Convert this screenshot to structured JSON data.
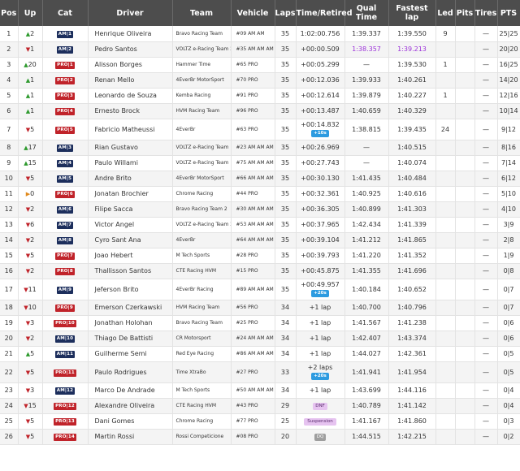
{
  "headers": [
    "Pos",
    "Up",
    "Cat",
    "Driver",
    "Team",
    "Vehicle",
    "Laps",
    "Time/Retired",
    "Qual Time",
    "Fastest lap",
    "Led",
    "Pits",
    "Tires",
    "PTS"
  ],
  "rows": [
    {
      "pos": "1",
      "dir": "up",
      "up": "2",
      "cat": "AM",
      "catn": "1",
      "driver": "Henrique Oliveira",
      "team": "Bravo Racing Team",
      "vehicle": "#09 AM AM",
      "laps": "35",
      "time": "1:02:00.756",
      "qual": "1:39.337",
      "fast": "1:39.550",
      "led": "9",
      "pits": "",
      "tires": "—",
      "pts": "25|25"
    },
    {
      "pos": "2",
      "dir": "down",
      "up": "1",
      "cat": "AM",
      "catn": "2",
      "driver": "Pedro Santos",
      "team": "VOLTZ e-Racing Team 2",
      "vehicle": "#35 AM AM AM",
      "laps": "35",
      "time": "+00:00.509",
      "qual": "1:38.357",
      "qualPurple": true,
      "fast": "1:39.213",
      "fastPurple": true,
      "led": "",
      "pits": "",
      "tires": "—",
      "pts": "20|20"
    },
    {
      "pos": "3",
      "dir": "up",
      "up": "20",
      "cat": "PRO",
      "catn": "1",
      "driver": "Alisson Borges",
      "team": "Hammer Time",
      "vehicle": "#65 PRO",
      "laps": "35",
      "time": "+00:05.299",
      "qual": "—",
      "fast": "1:39.530",
      "led": "1",
      "pits": "",
      "tires": "—",
      "pts": "16|25"
    },
    {
      "pos": "4",
      "dir": "up",
      "up": "1",
      "cat": "PRO",
      "catn": "2",
      "driver": "Renan Mello",
      "team": "4EverBr MotorSport",
      "vehicle": "#70 PRO",
      "laps": "35",
      "time": "+00:12.036",
      "qual": "1:39.933",
      "fast": "1:40.261",
      "led": "",
      "pits": "",
      "tires": "—",
      "pts": "14|20"
    },
    {
      "pos": "5",
      "dir": "up",
      "up": "1",
      "cat": "PRO",
      "catn": "3",
      "driver": "Leonardo de Souza",
      "team": "Kemba Racing",
      "vehicle": "#91 PRO",
      "laps": "35",
      "time": "+00:12.614",
      "qual": "1:39.879",
      "fast": "1:40.227",
      "led": "1",
      "pits": "",
      "tires": "—",
      "pts": "12|16"
    },
    {
      "pos": "6",
      "dir": "up",
      "up": "1",
      "cat": "PRO",
      "catn": "4",
      "driver": "Ernesto Brock",
      "team": "HVM Racing Team",
      "vehicle": "#96 PRO",
      "laps": "35",
      "time": "+00:13.487",
      "qual": "1:40.659",
      "fast": "1:40.329",
      "led": "",
      "pits": "",
      "tires": "—",
      "pts": "10|14"
    },
    {
      "pos": "7",
      "dir": "down",
      "up": "5",
      "cat": "PRO",
      "catn": "5",
      "driver": "Fabricio Matheussi",
      "team": "4EverBr",
      "vehicle": "#63 PRO",
      "laps": "35",
      "time": "+00:14.832",
      "pen": "+10s",
      "qual": "1:38.815",
      "fast": "1:39.435",
      "led": "24",
      "pits": "",
      "tires": "—",
      "pts": "9|12"
    },
    {
      "pos": "8",
      "dir": "up",
      "up": "17",
      "cat": "AM",
      "catn": "3",
      "driver": "Rian Gustavo",
      "team": "VOLTZ e-Racing Team",
      "vehicle": "#23 AM AM AM",
      "laps": "35",
      "time": "+00:26.969",
      "qual": "—",
      "fast": "1:40.515",
      "led": "",
      "pits": "",
      "tires": "—",
      "pts": "8|16"
    },
    {
      "pos": "9",
      "dir": "up",
      "up": "15",
      "cat": "AM",
      "catn": "4",
      "driver": "Paulo Willami",
      "team": "VOLTZ e-Racing Team",
      "vehicle": "#75 AM AM AM",
      "laps": "35",
      "time": "+00:27.743",
      "qual": "—",
      "fast": "1:40.074",
      "led": "",
      "pits": "",
      "tires": "—",
      "pts": "7|14"
    },
    {
      "pos": "10",
      "dir": "down",
      "up": "5",
      "cat": "AM",
      "catn": "5",
      "driver": "Andre Brito",
      "team": "4EverBr MotorSport",
      "vehicle": "#66 AM AM AM",
      "laps": "35",
      "time": "+00:30.130",
      "qual": "1:41.435",
      "fast": "1:40.484",
      "led": "",
      "pits": "",
      "tires": "—",
      "pts": "6|12"
    },
    {
      "pos": "11",
      "dir": "same",
      "up": "0",
      "cat": "PRO",
      "catn": "6",
      "driver": "Jonatan Brochier",
      "team": "Chrome Racing",
      "vehicle": "#44 PRO",
      "laps": "35",
      "time": "+00:32.361",
      "qual": "1:40.925",
      "fast": "1:40.616",
      "led": "",
      "pits": "",
      "tires": "—",
      "pts": "5|10"
    },
    {
      "pos": "12",
      "dir": "down",
      "up": "2",
      "cat": "AM",
      "catn": "6",
      "driver": "Filipe Sacca",
      "team": "Bravo Racing Team 2",
      "vehicle": "#30 AM AM AM",
      "laps": "35",
      "time": "+00:36.305",
      "qual": "1:40.899",
      "fast": "1:41.303",
      "led": "",
      "pits": "",
      "tires": "—",
      "pts": "4|10"
    },
    {
      "pos": "13",
      "dir": "down",
      "up": "6",
      "cat": "AM",
      "catn": "7",
      "driver": "Victor Angel",
      "team": "VOLTZ e-Racing Team 2",
      "vehicle": "#53 AM AM AM",
      "laps": "35",
      "time": "+00:37.965",
      "qual": "1:42.434",
      "fast": "1:41.339",
      "led": "",
      "pits": "",
      "tires": "—",
      "pts": "3|9"
    },
    {
      "pos": "14",
      "dir": "down",
      "up": "2",
      "cat": "AM",
      "catn": "8",
      "driver": "Cyro Sant Ana",
      "team": "4EverBr",
      "vehicle": "#64 AM AM AM",
      "laps": "35",
      "time": "+00:39.104",
      "qual": "1:41.212",
      "fast": "1:41.865",
      "led": "",
      "pits": "",
      "tires": "—",
      "pts": "2|8"
    },
    {
      "pos": "15",
      "dir": "down",
      "up": "5",
      "cat": "PRO",
      "catn": "7",
      "driver": "Joao Hebert",
      "team": "M Tech Sports",
      "vehicle": "#28 PRO",
      "laps": "35",
      "time": "+00:39.793",
      "qual": "1:41.220",
      "fast": "1:41.352",
      "led": "",
      "pits": "",
      "tires": "—",
      "pts": "1|9"
    },
    {
      "pos": "16",
      "dir": "down",
      "up": "2",
      "cat": "PRO",
      "catn": "8",
      "driver": "Thallisson Santos",
      "team": "CTE Racing HVM",
      "vehicle": "#15 PRO",
      "laps": "35",
      "time": "+00:45.875",
      "qual": "1:41.355",
      "fast": "1:41.696",
      "led": "",
      "pits": "",
      "tires": "—",
      "pts": "0|8"
    },
    {
      "pos": "17",
      "dir": "down",
      "up": "11",
      "cat": "AM",
      "catn": "9",
      "driver": "Jeferson Brito",
      "team": "4EverBr Racing",
      "vehicle": "#89 AM AM AM",
      "laps": "35",
      "time": "+00:49.957",
      "pen": "+20s",
      "qual": "1:40.184",
      "fast": "1:40.652",
      "led": "",
      "pits": "",
      "tires": "—",
      "pts": "0|7"
    },
    {
      "pos": "18",
      "dir": "down",
      "up": "10",
      "cat": "PRO",
      "catn": "9",
      "driver": "Emerson Czerkawski",
      "team": "HVM Racing Team",
      "vehicle": "#56 PRO",
      "laps": "34",
      "time": "+1 lap",
      "qual": "1:40.700",
      "fast": "1:40.796",
      "led": "",
      "pits": "",
      "tires": "—",
      "pts": "0|7"
    },
    {
      "pos": "19",
      "dir": "down",
      "up": "3",
      "cat": "PRO",
      "catn": "10",
      "driver": "Jonathan Holohan",
      "team": "Bravo Racing Team",
      "vehicle": "#25 PRO",
      "laps": "34",
      "time": "+1 lap",
      "qual": "1:41.567",
      "fast": "1:41.238",
      "led": "",
      "pits": "",
      "tires": "—",
      "pts": "0|6"
    },
    {
      "pos": "20",
      "dir": "down",
      "up": "2",
      "cat": "AM",
      "catn": "10",
      "driver": "Thiago De Battisti",
      "team": "CR Motorsport",
      "vehicle": "#24 AM AM AM",
      "laps": "34",
      "time": "+1 lap",
      "qual": "1:42.407",
      "fast": "1:43.374",
      "led": "",
      "pits": "",
      "tires": "—",
      "pts": "0|6"
    },
    {
      "pos": "21",
      "dir": "up",
      "up": "5",
      "cat": "AM",
      "catn": "11",
      "driver": "Guilherme Semi",
      "team": "Red Eye Racing",
      "vehicle": "#86 AM AM AM",
      "laps": "34",
      "time": "+1 lap",
      "qual": "1:44.027",
      "fast": "1:42.361",
      "led": "",
      "pits": "",
      "tires": "—",
      "pts": "0|5"
    },
    {
      "pos": "22",
      "dir": "down",
      "up": "5",
      "cat": "PRO",
      "catn": "11",
      "driver": "Paulo Rodrigues",
      "team": "Time XtraBo",
      "vehicle": "#27 PRO",
      "laps": "33",
      "time": "+2 laps",
      "pen": "+20s",
      "qual": "1:41.941",
      "fast": "1:41.954",
      "led": "",
      "pits": "",
      "tires": "—",
      "pts": "0|5"
    },
    {
      "pos": "23",
      "dir": "down",
      "up": "3",
      "cat": "AM",
      "catn": "12",
      "driver": "Marco De Andrade",
      "team": "M Tech Sports",
      "vehicle": "#50 AM AM AM",
      "laps": "34",
      "time": "+1 lap",
      "qual": "1:43.699",
      "fast": "1:44.116",
      "led": "",
      "pits": "",
      "tires": "—",
      "pts": "0|4"
    },
    {
      "pos": "24",
      "dir": "down",
      "up": "15",
      "cat": "PRO",
      "catn": "12",
      "driver": "Alexandre Oliveira",
      "team": "CTE Racing HVM",
      "vehicle": "#43 PRO",
      "laps": "29",
      "time": "",
      "status": "DNF",
      "statusClass": "dnf",
      "qual": "1:40.789",
      "fast": "1:41.142",
      "led": "",
      "pits": "",
      "tires": "—",
      "pts": "0|4"
    },
    {
      "pos": "25",
      "dir": "down",
      "up": "5",
      "cat": "PRO",
      "catn": "13",
      "driver": "Dani Gomes",
      "team": "Chrome Racing",
      "vehicle": "#77 PRO",
      "laps": "25",
      "time": "",
      "status": "Suspension",
      "statusClass": "susp",
      "qual": "1:41.167",
      "fast": "1:41.860",
      "led": "",
      "pits": "",
      "tires": "—",
      "pts": "0|3"
    },
    {
      "pos": "26",
      "dir": "down",
      "up": "5",
      "cat": "PRO",
      "catn": "14",
      "driver": "Martin Rossi",
      "team": "Rossi Competicione",
      "vehicle": "#08 PRO",
      "laps": "20",
      "time": "",
      "status": "DQ",
      "statusClass": "dq",
      "qual": "1:44.515",
      "fast": "1:42.215",
      "led": "",
      "pits": "",
      "tires": "—",
      "pts": "0|2"
    }
  ]
}
